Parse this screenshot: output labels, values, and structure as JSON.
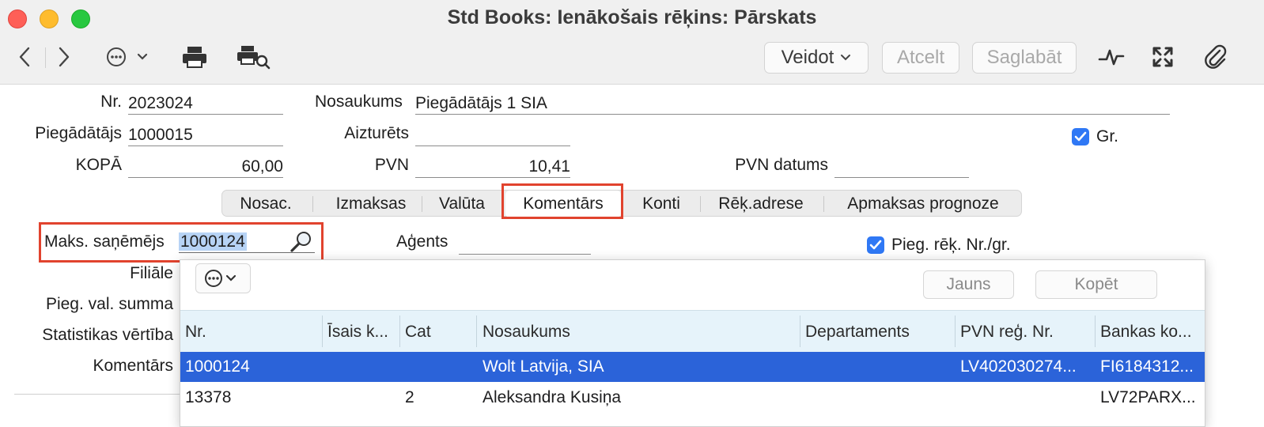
{
  "window": {
    "title": "Std Books: Ienākošais rēķins: Pārskats"
  },
  "toolbar": {
    "create_label": "Veidot",
    "cancel_label": "Atcelt",
    "save_label": "Saglabāt"
  },
  "form": {
    "nr_label": "Nr.",
    "nr_value": "2023024",
    "name_label": "Nosaukums",
    "name_value": "Piegādātājs 1 SIA",
    "supplier_label": "Piegādātājs",
    "supplier_value": "1000015",
    "on_hold_label": "Aizturēts",
    "on_hold_value": "",
    "gr_label": "Gr.",
    "total_label": "KOPĀ",
    "total_value": "60,00",
    "vat_label": "PVN",
    "vat_value": "10,41",
    "vat_date_label": "PVN datums",
    "vat_date_value": ""
  },
  "tabs": [
    {
      "label": "Nosac."
    },
    {
      "label": "Izmaksas"
    },
    {
      "label": "Valūta"
    },
    {
      "label": "Komentārs"
    },
    {
      "label": "Konti"
    },
    {
      "label": "Rēķ.adrese"
    },
    {
      "label": "Apmaksas prognoze"
    }
  ],
  "tab_panel": {
    "payee_label": "Maks. saņēmējs",
    "payee_value": "1000124",
    "agent_label": "Aģents",
    "agent_value": "",
    "supplier_inv_label": "Pieg. rēķ. Nr./gr.",
    "branch_label": "Filiāle",
    "supplier_cur_label": "Pieg. val. summa",
    "stat_value_label": "Statistikas vērtība",
    "comment_label": "Komentārs"
  },
  "popup": {
    "new_label": "Jauns",
    "copy_label": "Kopēt",
    "columns": [
      "Nr.",
      "Īsais k...",
      "Cat",
      "Nosaukums",
      "Departaments",
      "PVN reģ. Nr.",
      "Bankas ko..."
    ],
    "rows": [
      {
        "nr": "1000124",
        "short": "",
        "cat": "",
        "name": "Wolt Latvija, SIA",
        "dept": "",
        "vat": "LV402030274...",
        "bank": "FI6184312..."
      },
      {
        "nr": "13378",
        "short": "",
        "cat": "2",
        "name": "Aleksandra Kusiņa",
        "dept": "",
        "vat": "",
        "bank": "LV72PARX..."
      }
    ]
  },
  "colors": {
    "accent": "#2f78f5",
    "selection": "#2b63d9",
    "highlight": "#e1432e",
    "grid_header": "#e6f3fa"
  },
  "icons": [
    "back-icon",
    "forward-icon",
    "more-icon",
    "print-icon",
    "print-preview-icon",
    "activity-icon",
    "fullscreen-icon",
    "attachment-icon",
    "search-icon",
    "checkmark-icon"
  ]
}
